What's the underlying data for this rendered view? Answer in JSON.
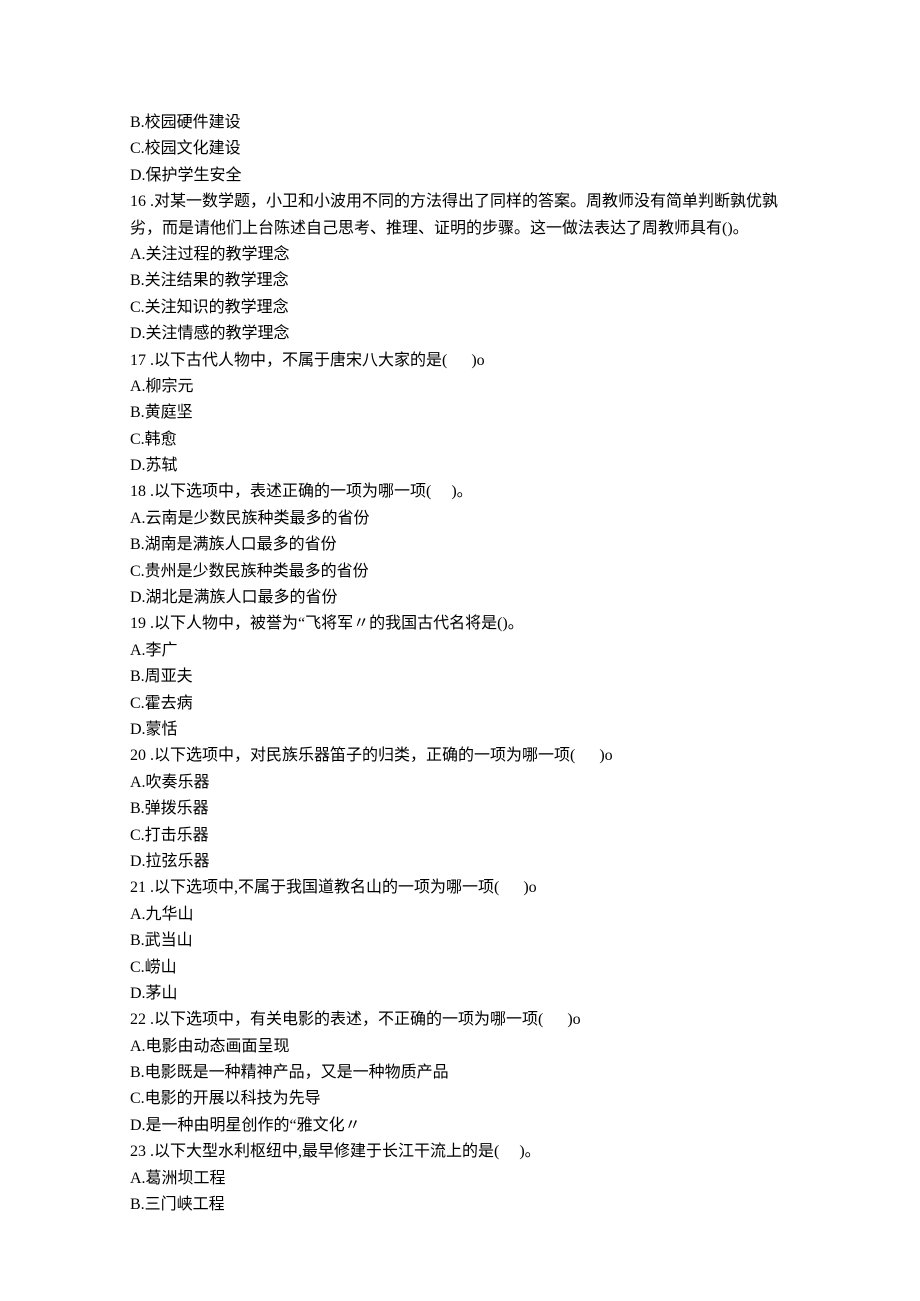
{
  "lead_options": [
    {
      "text": "B.校园硬件建设"
    },
    {
      "text": "C.校园文化建设"
    },
    {
      "text": "D.保护学生安全"
    }
  ],
  "questions": [
    {
      "num": "16",
      "stem_lines": [
        "16 .对某一数学题，小卫和小波用不同的方法得出了同样的答案。周教师没有简单判断孰优孰劣，而是请他们上台陈述自己思考、推理、证明的步骤。这一做法表达了周教师具有()。"
      ],
      "options": [
        "A.关注过程的教学理念",
        "B.关注结果的教学理念",
        "C.关注知识的教学理念",
        "D.关注情感的教学理念"
      ]
    },
    {
      "num": "17",
      "stem_lines": [
        "17 .以下古代人物中，不属于唐宋八大家的是(      )o"
      ],
      "options": [
        "A.柳宗元",
        "B.黄庭坚",
        "C.韩愈",
        "D.苏轼"
      ]
    },
    {
      "num": "18",
      "stem_lines": [
        "18 .以下选项中，表述正确的一项为哪一项(     )。"
      ],
      "options": [
        "A.云南是少数民族种类最多的省份",
        "B.湖南是满族人口最多的省份",
        "C.贵州是少数民族种类最多的省份",
        "D.湖北是满族人口最多的省份"
      ]
    },
    {
      "num": "19",
      "stem_lines": [
        "19 .以下人物中，被誉为“飞将军〃的我国古代名将是()。"
      ],
      "options": [
        "A.李广",
        "B.周亚夫",
        "C.霍去病",
        "D.蒙恬"
      ]
    },
    {
      "num": "20",
      "stem_lines": [
        "20 .以下选项中，对民族乐器笛子的归类，正确的一项为哪一项(      )o"
      ],
      "options": [
        "A.吹奏乐器",
        "B.弹拨乐器",
        "C.打击乐器",
        "D.拉弦乐器"
      ]
    },
    {
      "num": "21",
      "stem_lines": [
        "21 .以下选项中,不属于我国道教名山的一项为哪一项(      )o"
      ],
      "options": [
        "A.九华山",
        "B.武当山",
        "C.崂山",
        "D.茅山"
      ]
    },
    {
      "num": "22",
      "stem_lines": [
        "22 .以下选项中，有关电影的表述，不正确的一项为哪一项(      )o"
      ],
      "options": [
        "A.电影由动态画面呈现",
        "B.电影既是一种精神产品，又是一种物质产品",
        "C.电影的开展以科技为先导",
        "D.是一种由明星创作的“雅文化〃"
      ]
    },
    {
      "num": "23",
      "stem_lines": [
        "23 .以下大型水利枢纽中,最早修建于长江干流上的是(     )。"
      ],
      "options": [
        "A.葛洲坝工程",
        "B.三门峡工程"
      ]
    }
  ]
}
